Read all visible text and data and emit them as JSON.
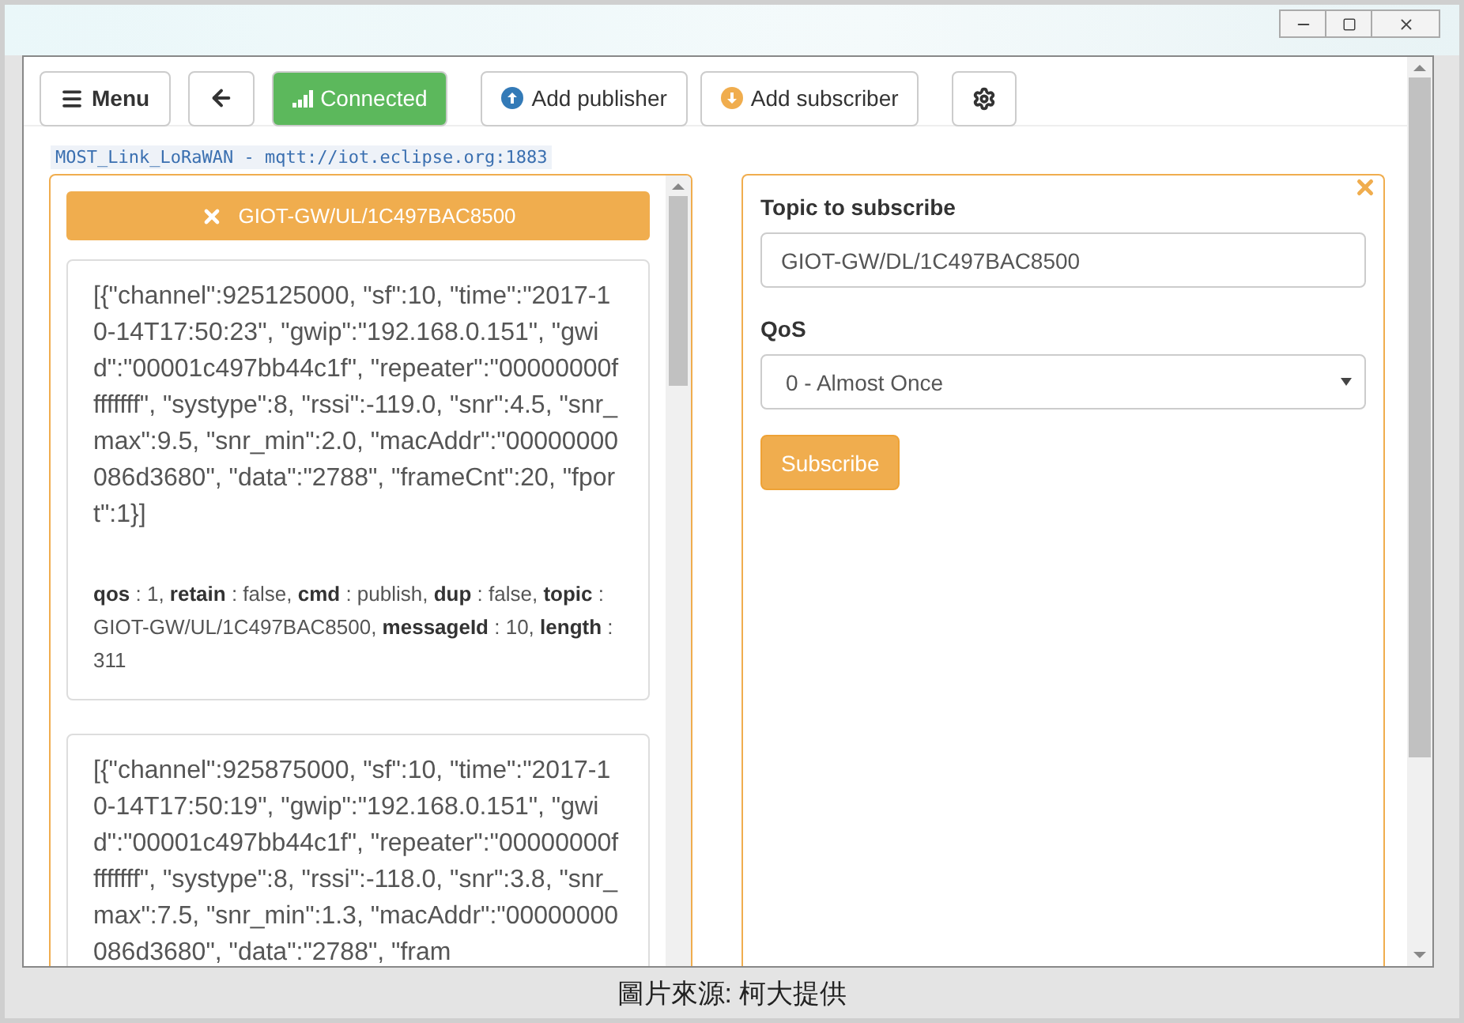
{
  "toolbar": {
    "menu_button": "Menu",
    "connection": {
      "label": "Connected",
      "connected": true
    },
    "add_publisher_button": "Add publisher",
    "add_subscriber_button": "Add subscriber"
  },
  "connection_label": "MOST_Link_LoRaWAN - mqtt://iot.eclipse.org:1883",
  "subscription": {
    "topic": "GIOT-GW/UL/1C497BAC8500",
    "messages": [
      {
        "payload": "[{\"channel\":925125000, \"sf\":10, \"time\":\"2017-10-14T17:50:23\", \"gwip\":\"192.168.0.151\", \"gwid\":\"00001c497bb44c1f\", \"repeater\":\"00000000ffffffff\", \"systype\":8, \"rssi\":-119.0, \"snr\":4.5, \"snr_max\":9.5, \"snr_min\":2.0, \"macAddr\":\"00000000086d3680\", \"data\":\"2788\", \"frameCnt\":20, \"fport\":1}]",
        "meta": "**qos** : 1, **retain** : false, **cmd** : publish, **dup** : false, **topic** : GIOT-GW/UL/1C497BAC8500, **messageId** : 10, **length** : 311"
      },
      {
        "payload": "[{\"channel\":925875000, \"sf\":10, \"time\":\"2017-10-14T17:50:19\", \"gwip\":\"192.168.0.151\", \"gwid\":\"00001c497bb44c1f\", \"repeater\":\"00000000ffffffff\", \"systype\":8, \"rssi\":-118.0, \"snr\":3.8, \"snr_max\":7.5, \"snr_min\":1.3, \"macAddr\":\"00000000086d3680\", \"data\":\"2788\", \"fram"
      }
    ]
  },
  "subscriber_form": {
    "topic_label": "Topic to subscribe",
    "topic_value": "GIOT-GW/DL/1C497BAC8500",
    "qos_label": "QoS",
    "qos_value": "0 - Almost Once",
    "subscribe_button": "Subscribe"
  },
  "caption": "圖片來源: 柯大提供"
}
